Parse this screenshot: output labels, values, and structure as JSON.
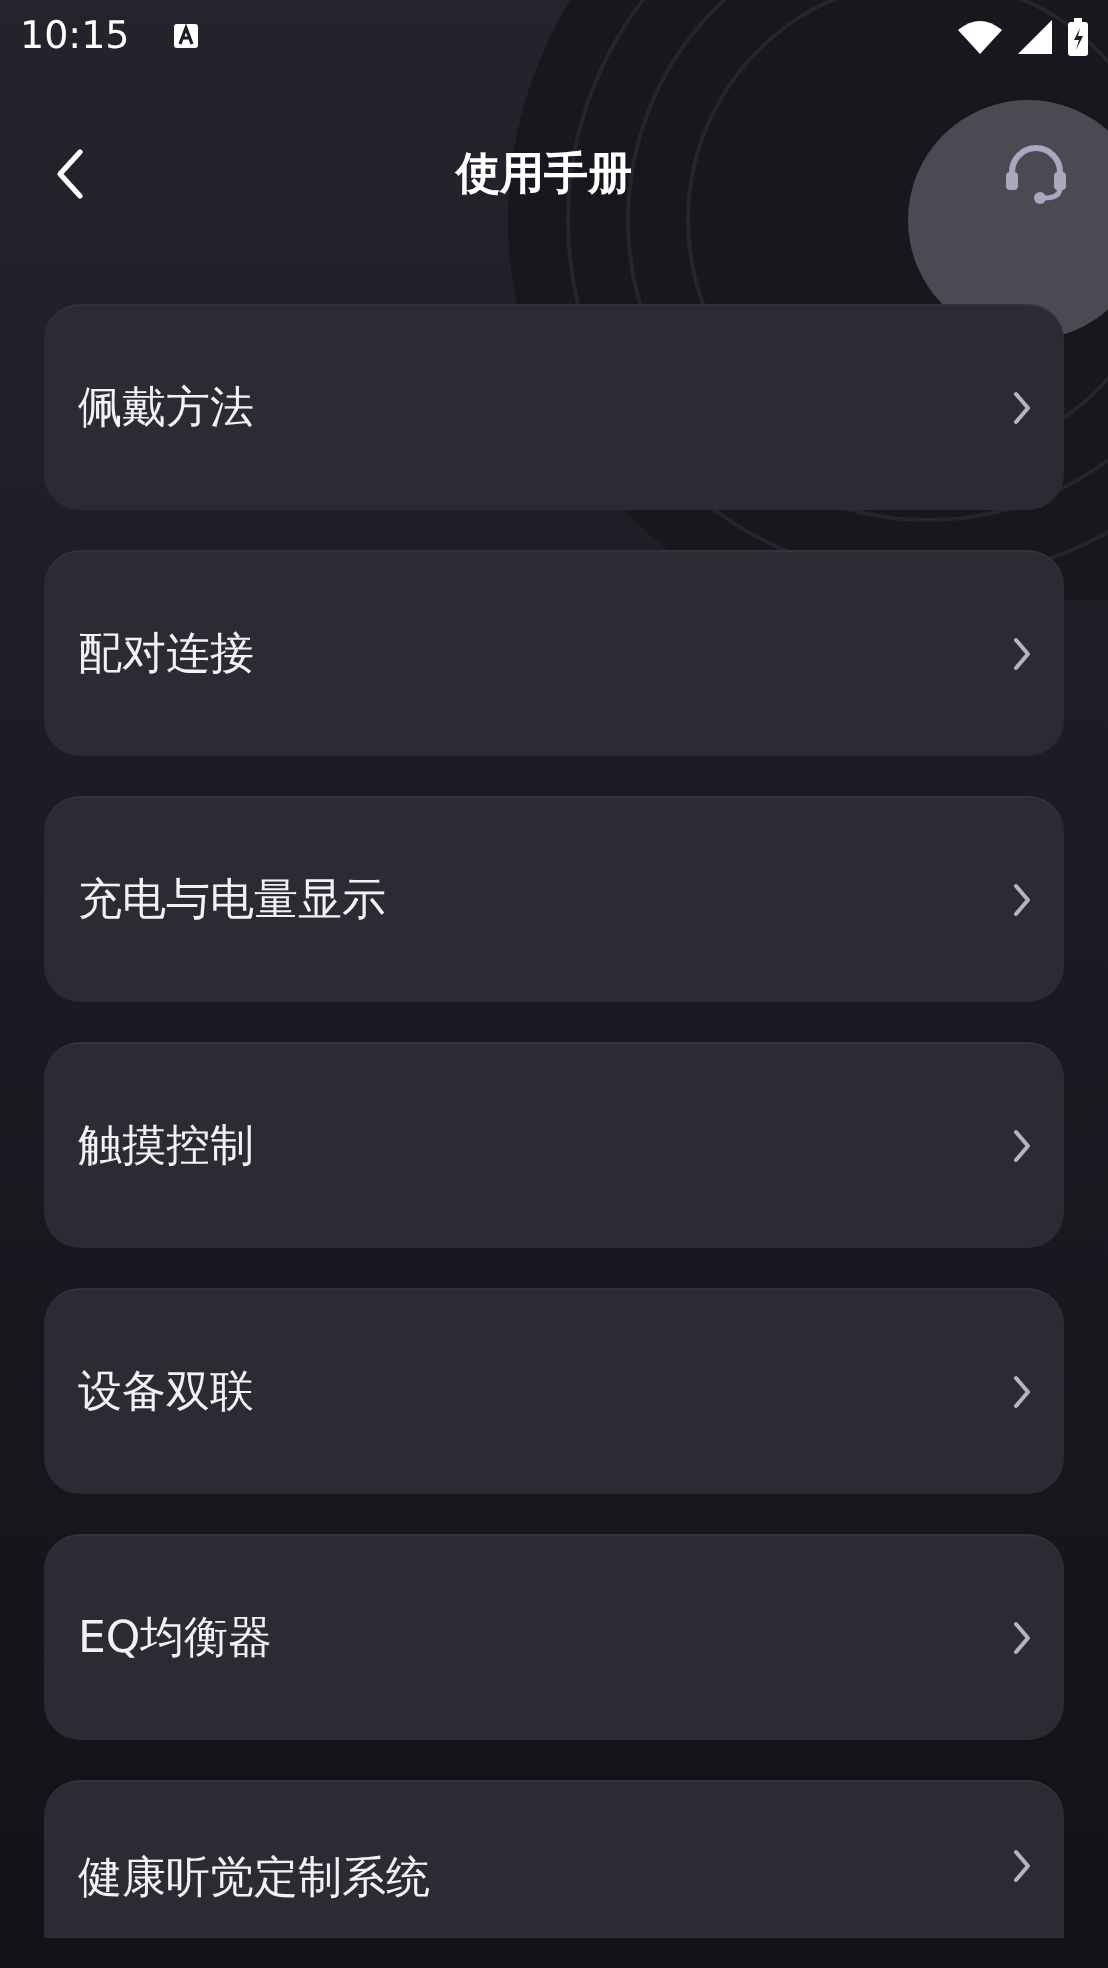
{
  "status_bar": {
    "time": "10:15"
  },
  "header": {
    "title": "使用手册"
  },
  "items": [
    {
      "label": "佩戴方法"
    },
    {
      "label": "配对连接"
    },
    {
      "label": "充电与电量显示"
    },
    {
      "label": "触摸控制"
    },
    {
      "label": "设备双联"
    },
    {
      "label": "EQ均衡器"
    },
    {
      "label": "健康听觉定制系统"
    }
  ]
}
